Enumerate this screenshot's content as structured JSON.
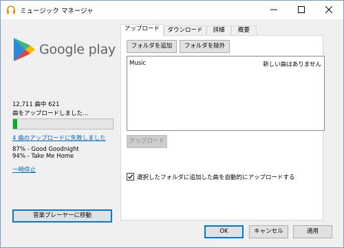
{
  "window": {
    "title": "ミュージック マネージャ"
  },
  "left": {
    "logo_text": "Google play",
    "count_text": "12,711 曲中 621",
    "status_text": "曲をアップロードしました...",
    "progress": 0.04,
    "failed_link": "4 曲のアップロードに失敗しました",
    "songs": [
      "87% - Good Goodnight",
      "94% - Take Me Home"
    ],
    "pause_link": "一時停止",
    "player_button": "音楽プレーヤーに移動"
  },
  "tabs": [
    "アップロード",
    "ダウンロード",
    "詳細",
    "概要"
  ],
  "upload": {
    "add_folder": "フォルダを追加",
    "remove_folder": "フォルダを除外",
    "folders": [
      {
        "name": "Music",
        "status": "新しい曲はありません"
      }
    ],
    "upload_button": "アップロード",
    "auto_upload_label": "選択したフォルダに追加した曲を自動的にアップロードする",
    "auto_upload_checked": true
  },
  "footer": {
    "ok": "OK",
    "cancel": "キャンセル",
    "apply": "適用"
  }
}
